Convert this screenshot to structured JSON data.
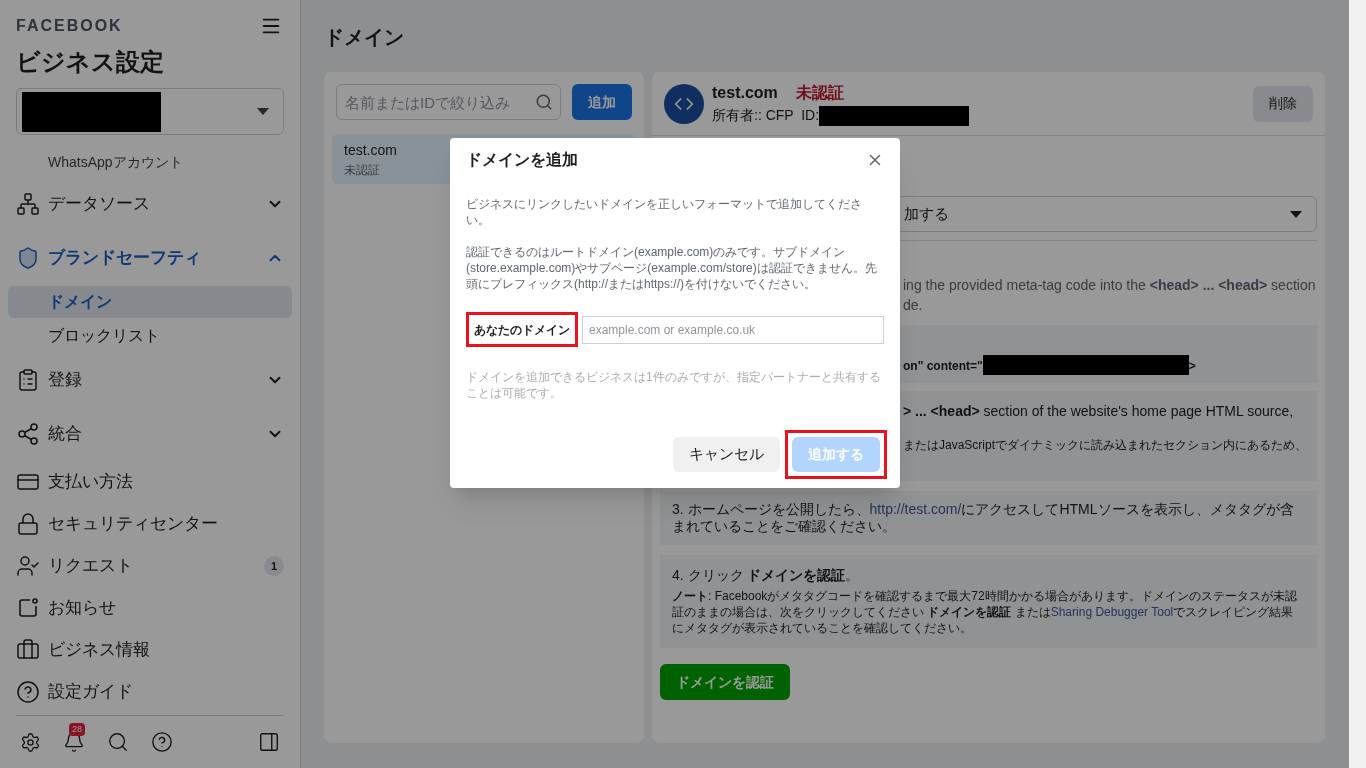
{
  "sidebar": {
    "brand": "FACEBOOK",
    "title": "ビジネス設定",
    "items": [
      {
        "kind": "sub",
        "label": "WhatsAppアカウント",
        "selected": false
      },
      {
        "kind": "section",
        "label": "データソース",
        "selected": false,
        "expanded": false
      },
      {
        "kind": "section",
        "label": "ブランドセーフティ",
        "selected": true,
        "expanded": true,
        "children": [
          {
            "label": "ドメイン",
            "selected": true
          },
          {
            "label": "ブロックリスト",
            "selected": false
          }
        ]
      },
      {
        "kind": "section",
        "label": "登録",
        "selected": false,
        "expanded": false
      },
      {
        "kind": "section",
        "label": "統合",
        "selected": false,
        "expanded": false
      },
      {
        "kind": "link",
        "label": "支払い方法",
        "selected": false
      },
      {
        "kind": "link",
        "label": "セキュリティセンター",
        "selected": false
      },
      {
        "kind": "link",
        "label": "リクエスト",
        "selected": false,
        "count": "1"
      },
      {
        "kind": "link",
        "label": "お知らせ",
        "selected": false
      },
      {
        "kind": "link",
        "label": "ビジネス情報",
        "selected": false
      },
      {
        "kind": "link",
        "label": "設定ガイド",
        "selected": false
      }
    ],
    "notification_count": "28"
  },
  "page": {
    "title": "ドメイン",
    "search": {
      "placeholder": "名前またはIDで絞り込み"
    },
    "add_button": "追加",
    "domains": [
      {
        "name": "test.com",
        "status": "未認証",
        "selected": true
      }
    ],
    "detail": {
      "name": "test.com",
      "status": "未認証",
      "owner": "所有者:: CFP  ID:",
      "delete_button": "削除",
      "method_select": "加する",
      "intro_lines": [
        "ing the provided meta-tag code into the **<head> ... <head>** section",
        "de."
      ],
      "code_parts": [
        "on\" content=\"",
        ">"
      ],
      "step2_lines": [
        "**> ... <head>** section of the website's home page HTML source,",
        "またはJavaScriptでダイナミックに読み込まれたセクション内にあるため、"
      ],
      "step3": {
        "before": "3. ホームページを公開したら、",
        "link": "http://test.com/",
        "after": "にアクセスしてHTMLソースを表示し、メタタグが含まれていることをご確認ください。"
      },
      "step4": {
        "title": "4. クリック **ドメインを認証**。",
        "before": "**ノート**: Facebookがメタタグコードを確認するまで最大72時間かかる場合があります。ドメインのステータスが未認証のままの場合は、次をクリックしてください **ドメインを認証** または",
        "link": "Sharing Debugger Tool",
        "after": "でスクレイピング結果にメタタグが表示されていることを確認してください。"
      },
      "verify_button": "ドメインを認証"
    }
  },
  "dialog": {
    "title": "ドメインを追加",
    "paragraphs": [
      "ビジネスにリンクしたいドメインを正しいフォーマットで追加してください。",
      "認証できるのはルートドメイン(example.com)のみです。サブドメイン(store.example.com)やサブページ(example.com/store)は認証できません。先頭にプレフィックス(http://またはhttps://)を付けないでください。"
    ],
    "field": {
      "label": "あなたのドメイン",
      "placeholder": "example.com or example.co.uk",
      "highlighted": true
    },
    "note": "ドメインを追加できるビジネスは1件のみですが、指定パートナーと共有することは可能です。",
    "cancel_button": "キャンセル",
    "submit_button": {
      "label": "追加する",
      "disabled": true,
      "highlighted": true
    }
  }
}
